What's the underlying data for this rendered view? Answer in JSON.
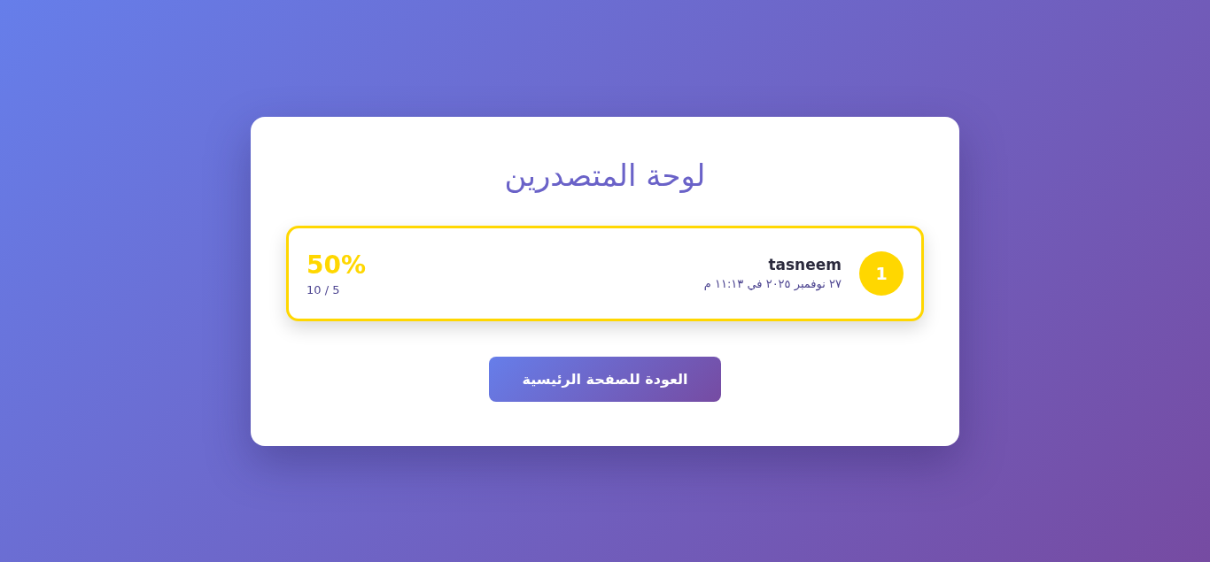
{
  "title": "لوحة المتصدرين",
  "entries": [
    {
      "rank": "1",
      "name": "tasneem",
      "date": "٢٧ نوفمبر ٢٠٢٥ في ١١:١٣ م",
      "score": "50%",
      "points": "5 / 10",
      "color": "#ffd700"
    }
  ],
  "back_button": {
    "label": "العودة للصفحة الرئيسية"
  }
}
